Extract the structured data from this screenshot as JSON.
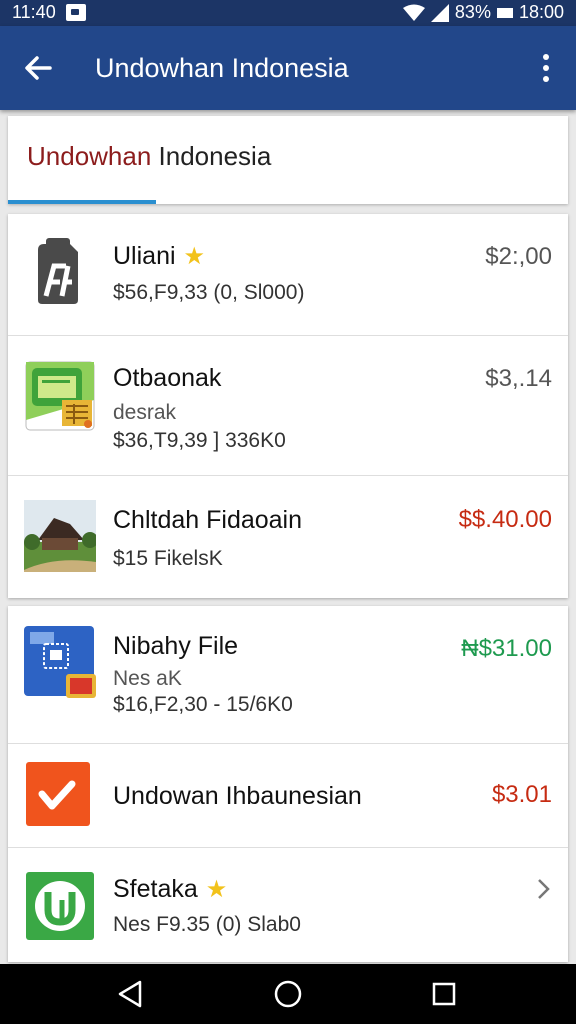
{
  "status_bar": {
    "time_left": "11:40",
    "battery": "83%",
    "clock": "18:00"
  },
  "app_bar": {
    "title": "Undowhan Indonesia"
  },
  "tab": {
    "label_accent": "Undowhan",
    "label_rest": " Indonesia"
  },
  "list": [
    {
      "name": "Uliani",
      "starred": true,
      "sub1": "$56,F9,33 (0, Sl000)",
      "sub2": "",
      "price": "$2:,00",
      "price_color": "#555555",
      "icon": "document-app-icon"
    },
    {
      "name": "Otbaonak",
      "starred": false,
      "sub1": "desrak",
      "sub2": "$36,T9,39 ] 336K0",
      "price": "$3,.14",
      "price_color": "#555555",
      "icon": "spreadsheet-app-icon"
    },
    {
      "name": "Chltdah Fidaoain",
      "starred": false,
      "sub1": "$15 FikelsK",
      "sub2": "",
      "price": "$$.40.00",
      "price_color": "#c62b12",
      "icon": "landscape-photo-icon"
    },
    {
      "name": "Nibahy File",
      "starred": false,
      "sub1": "Nes aK",
      "sub2": "$16,F2,30 - 15/6K0",
      "price": "₦$31.00",
      "price_color": "#1e9a4f",
      "icon": "calendar-app-icon"
    },
    {
      "name": "Undowan Ihbaunesian",
      "starred": false,
      "sub1": "",
      "sub2": "",
      "price": "$3.01",
      "price_color": "#c62b12",
      "icon": "checkmark-app-icon"
    },
    {
      "name": "Sfetaka",
      "starred": true,
      "sub1": "Nes F9.35 (0) Slab0",
      "sub2": "",
      "price": "",
      "price_color": "#555555",
      "icon": "u-logo-app-icon"
    }
  ],
  "colors": {
    "app_bar": "#22478a",
    "status_bar": "#1c3566",
    "tab_indicator": "#2a8fd0",
    "star": "#f2c21b"
  }
}
